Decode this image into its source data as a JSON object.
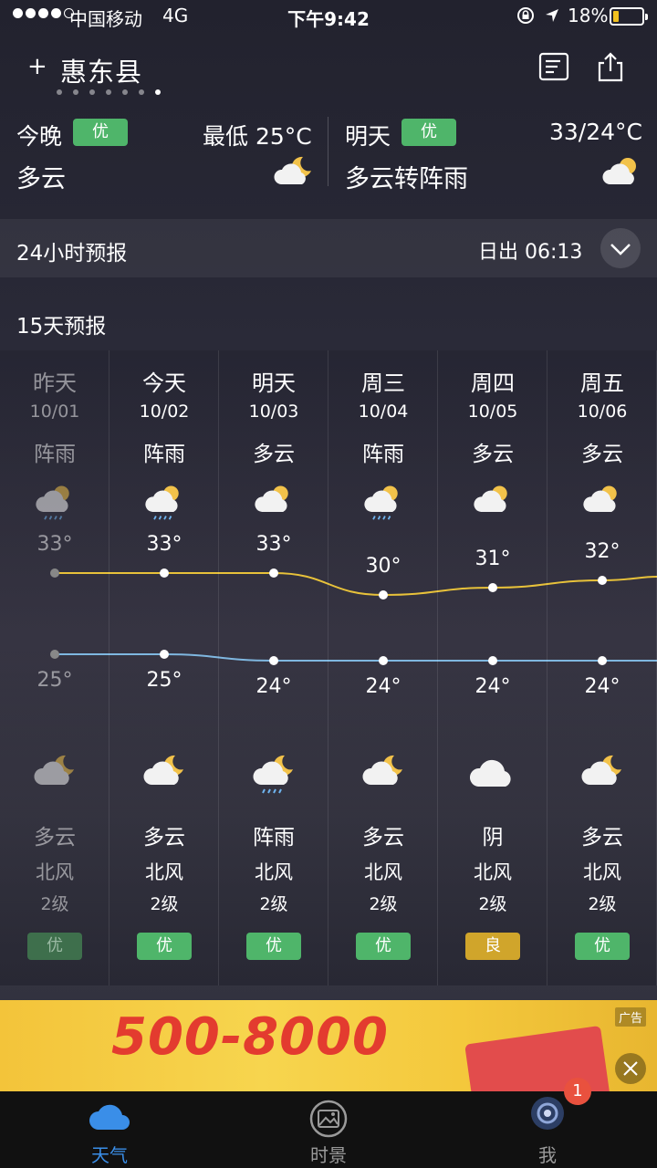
{
  "status_bar": {
    "carrier": "中国移动",
    "network": "4G",
    "time": "下午9:42",
    "battery": "18%"
  },
  "header": {
    "add": "+",
    "city": "惠东县",
    "pages": 7,
    "active_page": 6
  },
  "tonight": {
    "label": "今晚",
    "aqi": "优",
    "low": "最低 25°C",
    "condition": "多云"
  },
  "tomorrow": {
    "label": "明天",
    "aqi": "优",
    "range": "33/24°C",
    "condition": "多云转阵雨"
  },
  "hourly": {
    "title": "24小时预报",
    "sunrise": "日出 06:13"
  },
  "daily": {
    "title": "15天预报",
    "days": [
      {
        "day": "昨天",
        "date": "10/01",
        "day_weather": "阵雨",
        "day_icon": "rain-cloud-icon",
        "high": "33°",
        "low": "25°",
        "night_icon": "moon-cloud-icon",
        "night_weather": "多云",
        "wind": "北风",
        "level": "2级",
        "aqi": "优",
        "aqi_color": "#3e6f4c",
        "past": true
      },
      {
        "day": "今天",
        "date": "10/02",
        "day_weather": "阵雨",
        "day_icon": "rain-cloud-icon",
        "high": "33°",
        "low": "25°",
        "night_icon": "moon-cloud-icon",
        "night_weather": "多云",
        "wind": "北风",
        "level": "2级",
        "aqi": "优",
        "aqi_color": "#4fb56a",
        "past": false
      },
      {
        "day": "明天",
        "date": "10/03",
        "day_weather": "多云",
        "day_icon": "sun-cloud-icon",
        "high": "33°",
        "low": "24°",
        "night_icon": "moon-rain-icon",
        "night_weather": "阵雨",
        "wind": "北风",
        "level": "2级",
        "aqi": "优",
        "aqi_color": "#4fb56a",
        "past": false
      },
      {
        "day": "周三",
        "date": "10/04",
        "day_weather": "阵雨",
        "day_icon": "rain-cloud-icon",
        "high": "30°",
        "low": "24°",
        "night_icon": "moon-cloud-icon",
        "night_weather": "多云",
        "wind": "北风",
        "level": "2级",
        "aqi": "优",
        "aqi_color": "#4fb56a",
        "past": false
      },
      {
        "day": "周四",
        "date": "10/05",
        "day_weather": "多云",
        "day_icon": "sun-cloud-icon",
        "high": "31°",
        "low": "24°",
        "night_icon": "cloud-icon",
        "night_weather": "阴",
        "wind": "北风",
        "level": "2级",
        "aqi": "良",
        "aqi_color": "#d0a52b",
        "past": false
      },
      {
        "day": "周五",
        "date": "10/06",
        "day_weather": "多云",
        "day_icon": "sun-cloud-icon",
        "high": "32°",
        "low": "24°",
        "night_icon": "moon-cloud-icon",
        "night_weather": "多云",
        "wind": "北风",
        "level": "2级",
        "aqi": "优",
        "aqi_color": "#4fb56a",
        "past": false
      }
    ]
  },
  "ad": {
    "headline": "500-8000",
    "tag": "广告"
  },
  "tabs": [
    {
      "label": "天气",
      "icon": "cloud-tab-icon",
      "active": true
    },
    {
      "label": "时景",
      "icon": "photo-tab-icon",
      "active": false
    },
    {
      "label": "我",
      "icon": "avatar-tab-icon",
      "active": false
    }
  ],
  "badge": "1",
  "colors": {
    "accent": "#3a8ee8",
    "high_line": "#e8c23a",
    "low_line": "#7fb7e0",
    "aqi_good": "#4fb56a",
    "aqi_moderate": "#d0a52b"
  }
}
